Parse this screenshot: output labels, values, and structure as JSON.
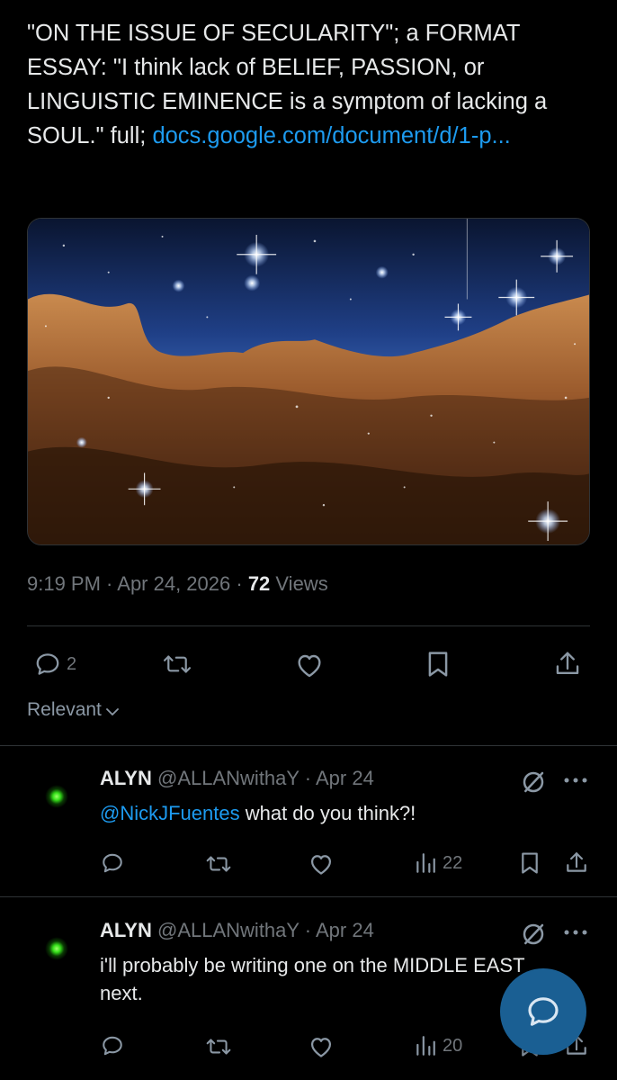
{
  "tweet": {
    "text": "\"ON THE ISSUE OF SECULARITY\"; a FORMAT ESSAY: \"I think lack of BELIEF, PASSION, or LINGUISTIC EMINENCE is a symptom of lacking a SOUL.\" full; ",
    "link_text": "docs.google.com/document/d/1-p...",
    "time": "9:19 PM · Apr 24, 2026 · ",
    "views_count": "72",
    "views_label": " Views",
    "reply_count": "2"
  },
  "filter": {
    "label": "Relevant"
  },
  "replies": [
    {
      "name": "ALYN",
      "handle": "@ALLANwithaY · Apr 24",
      "mention": "@NickJFuentes",
      "text": " what do you think?!",
      "views": "22"
    },
    {
      "name": "ALYN",
      "handle": "@ALLANwithaY · Apr 24",
      "mention": "",
      "text": "i'll probably be writing one on the MIDDLE EAST next.",
      "views": "20"
    }
  ],
  "colors": {
    "background": "#000000",
    "text": "#e7e9ea",
    "muted": "#71767b",
    "link": "#1d9bf0",
    "fab": "#1a5f93"
  },
  "icons": {
    "reply": "reply-icon",
    "retweet": "retweet-icon",
    "like": "heart-icon",
    "bookmark": "bookmark-icon",
    "share": "share-icon",
    "views": "views-icon",
    "grok": "grok-icon",
    "more": "more-icon",
    "compose": "compose-reply-icon"
  }
}
